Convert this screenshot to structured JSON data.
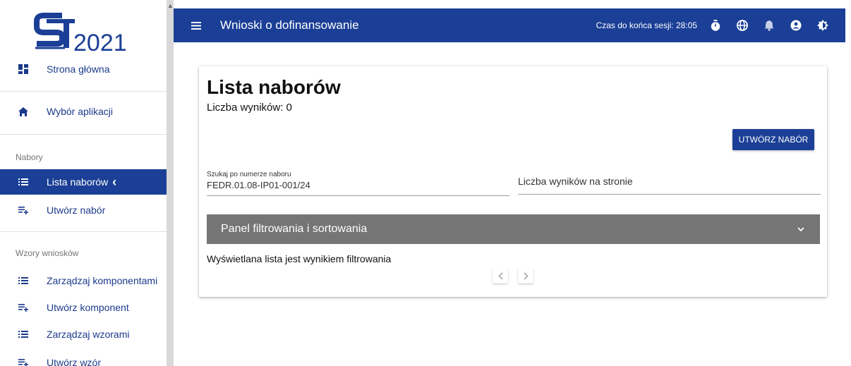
{
  "logo": {
    "text": "2021"
  },
  "sidebar": {
    "items_top": [
      {
        "label": "Strona główna",
        "icon": "dashboard-icon"
      },
      {
        "label": "Wybór aplikacji",
        "icon": "home-icon"
      }
    ],
    "section_nabory": "Nabory",
    "nabory_items": [
      {
        "label": "Lista naborów",
        "icon": "list-icon",
        "active": true
      },
      {
        "label": "Utwórz nabór",
        "icon": "playlist-add-icon"
      }
    ],
    "section_wzory": "Wzory wniosków",
    "wzory_items": [
      {
        "label": "Zarządzaj komponentami",
        "icon": "list-icon"
      },
      {
        "label": "Utwórz komponent",
        "icon": "playlist-add-icon"
      },
      {
        "label": "Zarządzaj wzorami",
        "icon": "list-icon"
      },
      {
        "label": "Utwórz wzór",
        "icon": "playlist-add-icon"
      }
    ],
    "active_chevron": "‹"
  },
  "topbar": {
    "title": "Wnioski o dofinansowanie",
    "session": "Czas do końca sesji: 28:05",
    "icons": [
      "timer-icon",
      "globe-icon",
      "bell-icon",
      "account-icon",
      "contrast-icon"
    ]
  },
  "card": {
    "title": "Lista naborów",
    "count": "Liczba wyników: 0",
    "create_button": "UTWÓRZ NABÓR",
    "search": {
      "label": "Szukaj po numerze naboru",
      "value": "FEDR.01.08-IP01-001/24"
    },
    "per_page_label": "Liczba wyników na stronie",
    "filter_panel_title": "Panel filtrowania i sortowania",
    "filter_note": "Wyświetlana lista jest wynikiem filtrowania"
  },
  "colors": {
    "primary": "#1b3f96",
    "panel": "#757575"
  }
}
